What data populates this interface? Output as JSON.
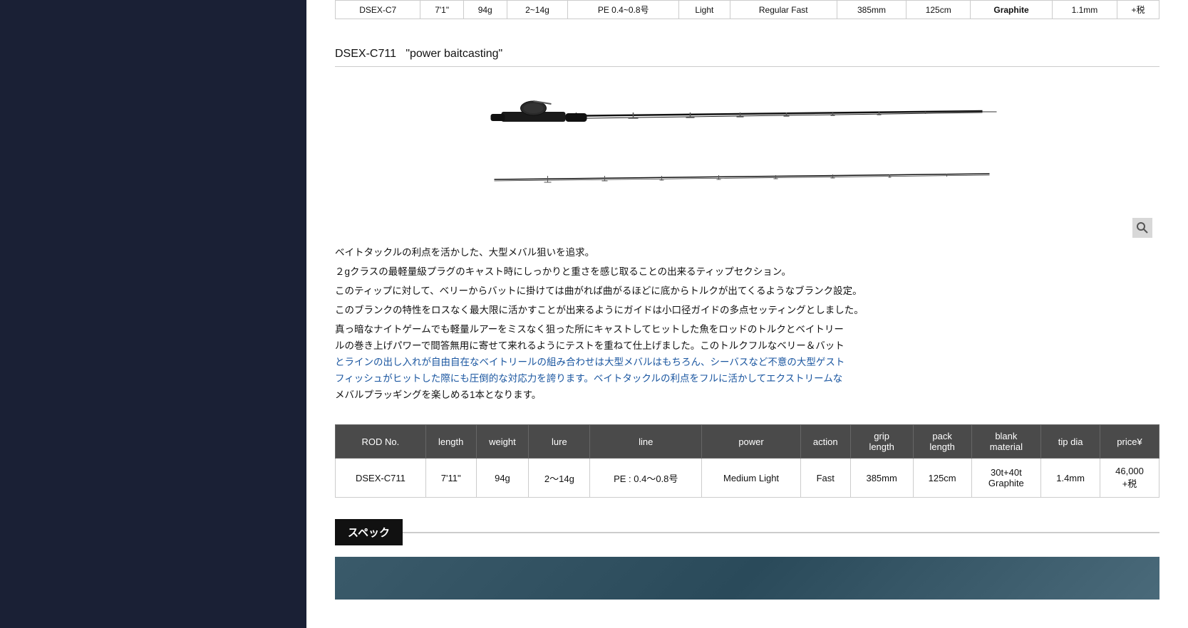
{
  "top_table": {
    "cells": [
      "DSEX-C7",
      "7'1\"",
      "94g",
      "2~14g",
      "PE 0.4~0.8号",
      "Light",
      "Regular Fast",
      "385mm",
      "125cm",
      "Graphite",
      "1.1mm",
      "+税"
    ]
  },
  "product": {
    "title": "DSEX-C711",
    "subtitle": "\"power baitcasting\"",
    "rod_alt": "DSEX-C711 fishing rod"
  },
  "description": {
    "para1": "ベイトタックルの利点を活かした、大型メバル狙いを追求。",
    "para2": "２gクラスの最軽量級プラグのキャスト時にしっかりと重さを感じ取ることの出来るティップセクション。",
    "para3": "このティップに対して、ベリーからバットに掛けては曲がれば曲がるほどに底からトルクが出てくるようなブランク設定。",
    "para4": "このブランクの特性をロスなく最大限に活かすことが出来るようにガイドは小口径ガイドの多点セッティングとしました。",
    "para5_part1": "真っ暗なナイトゲームでも軽量ルアーをミスなく狙った所にキャストしてヒットした魚をロッドのトルクとベイトリー",
    "para5_part2": "ルの巻き上げパワーで間答無用に寄せて来れるようにテストを重ねて仕上げました。このトルクフルなベリー＆バット",
    "para5_part3": "とラインの出し入れが自由自在なベイトリールの組み合わせは大型メバルはもちろん、シーバスなど不意の大型ゲスト",
    "para5_part4": "フィッシュがヒットした際にも圧倒的な対応力を誇ります。ベイトタックルの利点をフルに活かしてエクストリームな",
    "para5_part5": "メバルプラッギングを楽しめる1本となります。"
  },
  "specs_table": {
    "headers": [
      "ROD No.",
      "length",
      "weight",
      "lure",
      "line",
      "power",
      "action",
      "grip\nlength",
      "pack\nlength",
      "blank\nmaterial",
      "tip dia",
      "price¥"
    ],
    "row": {
      "rod_no": "DSEX-C711",
      "length": "7'11\"",
      "weight": "94g",
      "lure": "2〜14g",
      "line": "PE : 0.4〜0.8号",
      "power": "Medium Light",
      "action": "Fast",
      "grip_length": "385mm",
      "pack_length": "125cm",
      "blank_material": "30t+40t\nGraphite",
      "tip_dia": "1.4mm",
      "price": "46,000\n+税"
    }
  },
  "section": {
    "title": "スペック"
  },
  "zoom_icon": "🔍"
}
